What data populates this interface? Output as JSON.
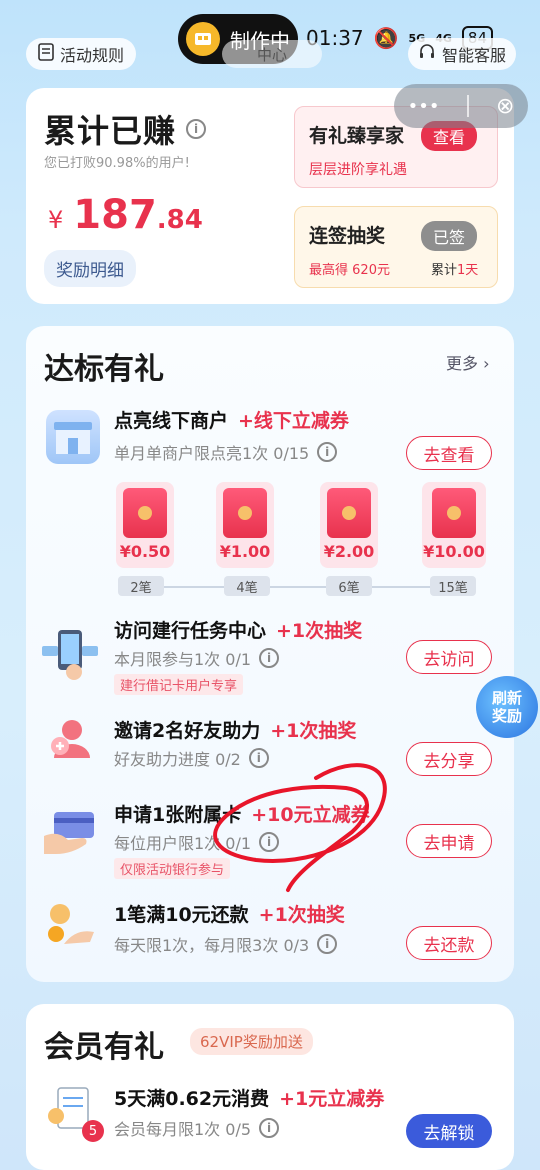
{
  "status_bar": {
    "recording_label": "制作中",
    "time": "01:37",
    "network": "5G",
    "network2": "4G",
    "battery": "84"
  },
  "top": {
    "rules_label": "活动规则",
    "center_tab": "中心",
    "service_label": "智能客服",
    "capsule_more": "•••",
    "capsule_close": "⊗"
  },
  "earned": {
    "title": "累计已赚",
    "subtitle": "您已打败90.98%的用户!",
    "currency": "¥",
    "amount_int": "187",
    "amount_dec": ".84",
    "detail_button": "奖励明细",
    "vip_card": {
      "title": "有礼臻享家",
      "button": "查看",
      "subtitle": "层层进阶享礼遇"
    },
    "lottery_card": {
      "title": "连签抽奖",
      "button": "已签",
      "max_label": "最高得",
      "max_value": "620元",
      "total_label": "累计",
      "total_days": "1天"
    }
  },
  "tasks_section": {
    "title": "达标有礼",
    "more": "更多 ›",
    "tasks": [
      {
        "title": "点亮线下商户",
        "reward": "+线下立减券",
        "sub": "单月单商户限点亮1次 0/15",
        "button": "去查看"
      },
      {
        "title": "访问建行任务中心",
        "reward": "+1次抽奖",
        "sub": "本月限参与1次 0/1",
        "tag": "建行借记卡用户专享",
        "button": "去访问"
      },
      {
        "title": "邀请2名好友助力",
        "reward": "+1次抽奖",
        "sub": "好友助力进度 0/2",
        "button": "去分享"
      },
      {
        "title": "申请1张附属卡",
        "reward": "+10元立减券",
        "sub": "每位用户限1次 0/1",
        "tag": "仅限活动银行参与",
        "button": "去申请"
      },
      {
        "title": "1笔满10元还款",
        "reward": "+1次抽奖",
        "sub": "每天限1次，每月限3次 0/3",
        "button": "去还款"
      }
    ],
    "envelopes": [
      {
        "value": "¥0.50",
        "step": "2笔"
      },
      {
        "value": "¥1.00",
        "step": "4笔"
      },
      {
        "value": "¥2.00",
        "step": "6笔"
      },
      {
        "value": "¥10.00",
        "step": "15笔"
      }
    ]
  },
  "float_button": {
    "line1": "刷新",
    "line2": "奖励"
  },
  "member_section": {
    "title": "会员有礼",
    "vip_tag": "62VIP奖励加送",
    "task": {
      "title": "5天满0.62元消费",
      "reward": "+1元立减券",
      "sub": "会员每月限1次 0/5",
      "button": "去解锁",
      "badge": "5"
    }
  },
  "colors": {
    "accent_red": "#e8324d",
    "accent_blue": "#3b5bdb",
    "annotation": "#e8152a"
  }
}
